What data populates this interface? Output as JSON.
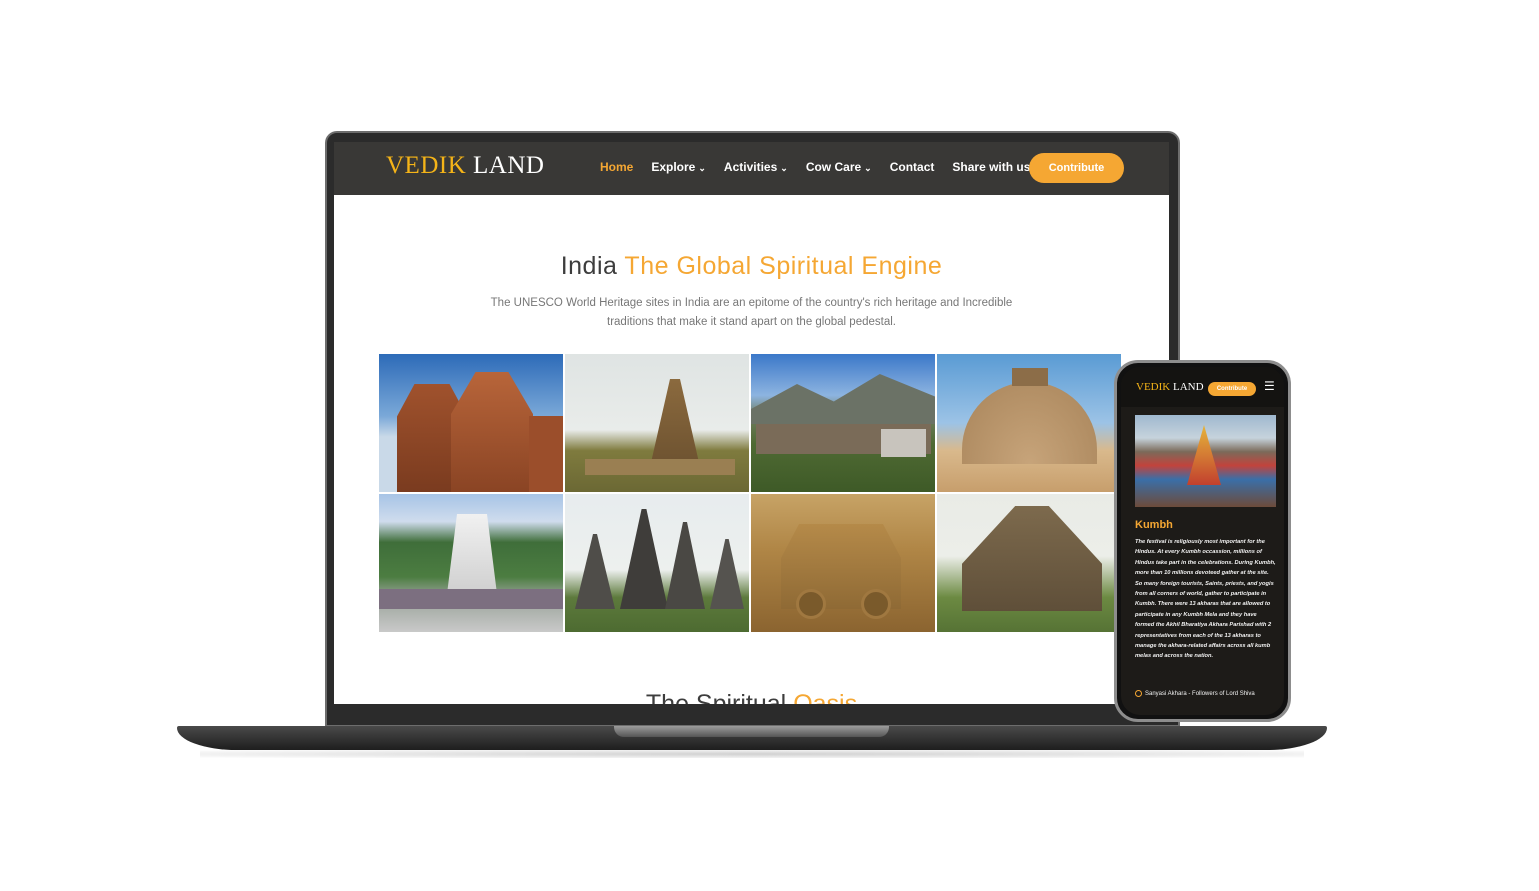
{
  "site": {
    "logo_part1": "VEDIK",
    "logo_part2": "LAND"
  },
  "nav": {
    "items": [
      {
        "label": "Home",
        "active": true
      },
      {
        "label": "Explore",
        "dropdown": true
      },
      {
        "label": "Activities",
        "dropdown": true
      },
      {
        "label": "Cow Care",
        "dropdown": true
      },
      {
        "label": "Contact"
      },
      {
        "label": "Share with us"
      }
    ],
    "cta_label": "Contribute"
  },
  "hero": {
    "title_part1": "India",
    "title_part2": "The Global Spiritual Engine",
    "subtitle": "The UNESCO World Heritage sites in India are an epitome of the country's rich heritage and Incredible traditions that make it stand apart on the global pedestal."
  },
  "next_section": {
    "title_part1": "The Spiritual",
    "title_part2": "Oasis"
  },
  "mobile": {
    "logo_part1": "VEDIK",
    "logo_part2": "LAND",
    "cta_label": "Contribute",
    "menu_icon": "hamburger-icon",
    "heading": "Kumbh",
    "body": "The festival is religiously most important for the Hindus. At every Kumbh occassion, millions of Hindus take part in the celebrations. During Kumbh, more than 10 millions devoteed gather at the site. So many foreign tourists, Saints, priests, and yogis from all corners of world, gather to participate in Kumbh. There were 13 akharas that are allowed to participate in any Kumbh Mela and they have formed the Akhil Bharatiya Akhara Parishad with 2 representatives from each of the 13 akharas to manage the akhara-related affairs across all kumb melas and across the nation.",
    "list_item_1": "Sanyasi Akhara - Followers of Lord Shiva"
  },
  "colors": {
    "accent": "#f5a733",
    "logo_gold": "#f5b418",
    "nav_bg": "#393836"
  }
}
